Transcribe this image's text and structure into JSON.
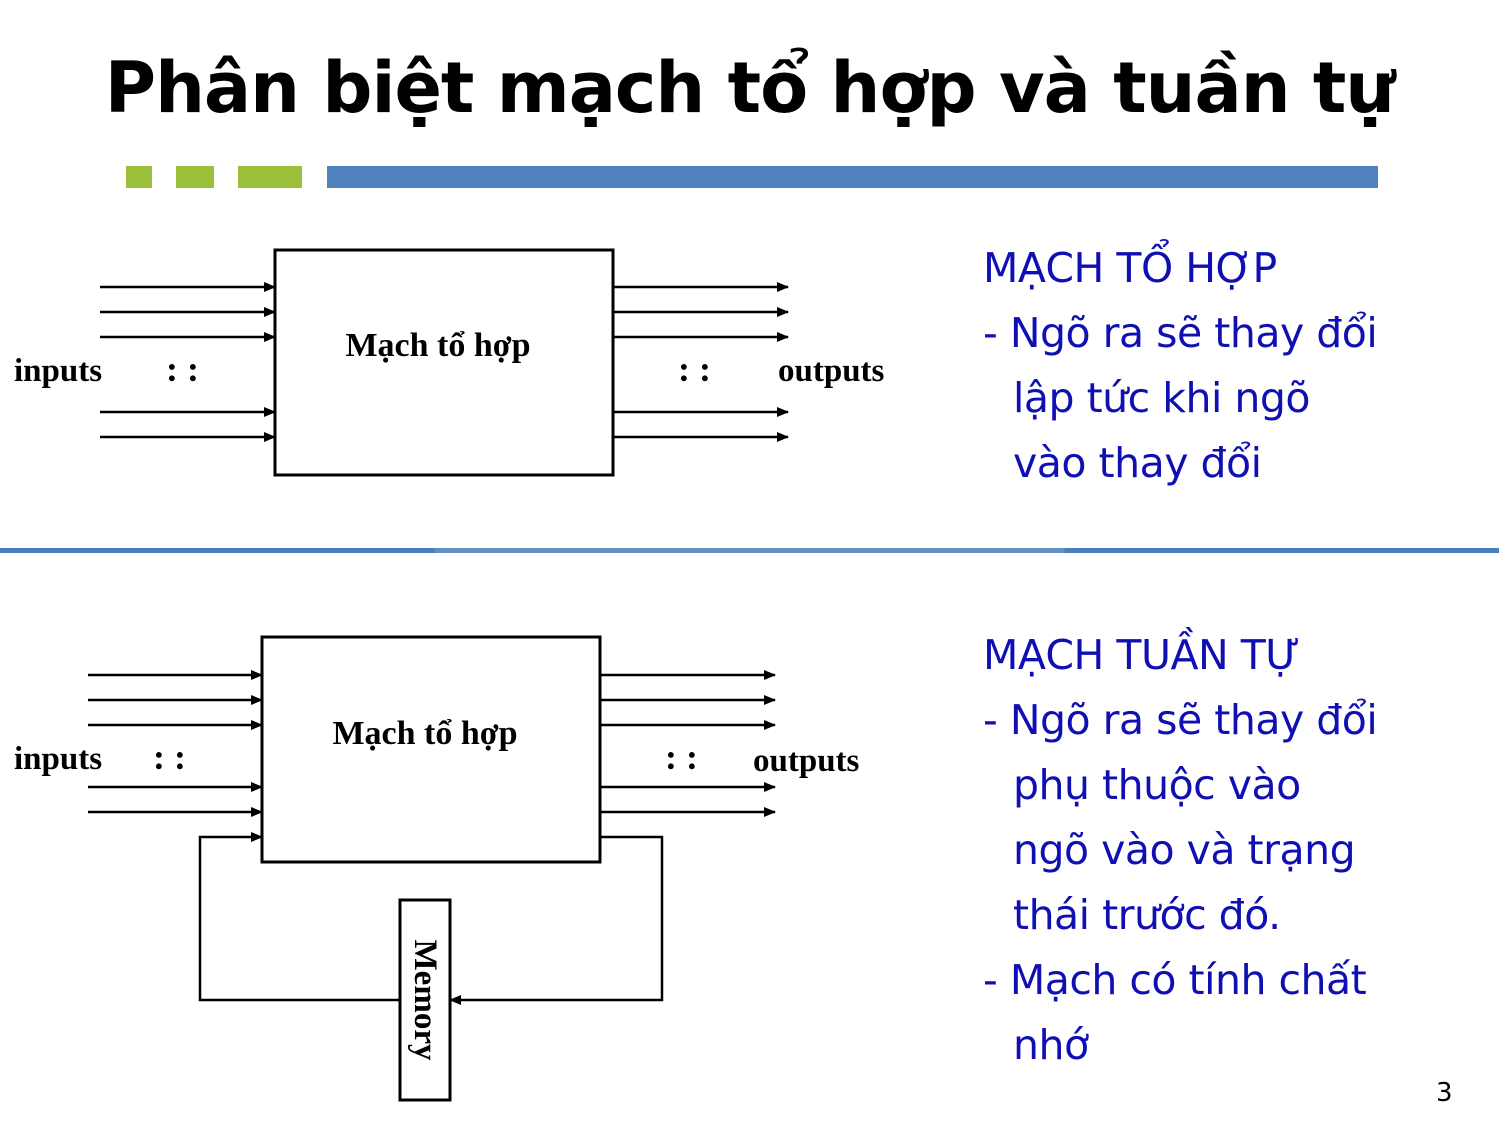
{
  "slide": {
    "title": "Phân biệt mạch tổ hợp và tuần tự",
    "page_number": "3",
    "colors": {
      "accent_green": "#9bc13c",
      "accent_blue": "#4f81bd",
      "note_text": "#0f0fb4"
    }
  },
  "diagram_combinational": {
    "block_label": "Mạch tổ hợp",
    "inputs_label": "inputs",
    "outputs_label": "outputs",
    "ellipsis": ": :"
  },
  "diagram_sequential": {
    "block_label": "Mạch tổ hợp",
    "inputs_label": "inputs",
    "outputs_label": "outputs",
    "ellipsis": ": :",
    "memory_label": "Memory"
  },
  "notes_combinational": {
    "heading": "MẠCH TỔ HỢP",
    "lines": [
      "- Ngõ ra sẽ thay đổi",
      "lập tức khi ngõ",
      "vào thay đổi"
    ]
  },
  "notes_sequential": {
    "heading": "MẠCH TUẦN TỰ",
    "lines": [
      "- Ngõ ra sẽ thay đổi",
      "phụ thuộc vào",
      "ngõ vào và trạng",
      "thái trước đó.",
      "- Mạch có tính chất",
      "nhớ"
    ]
  }
}
